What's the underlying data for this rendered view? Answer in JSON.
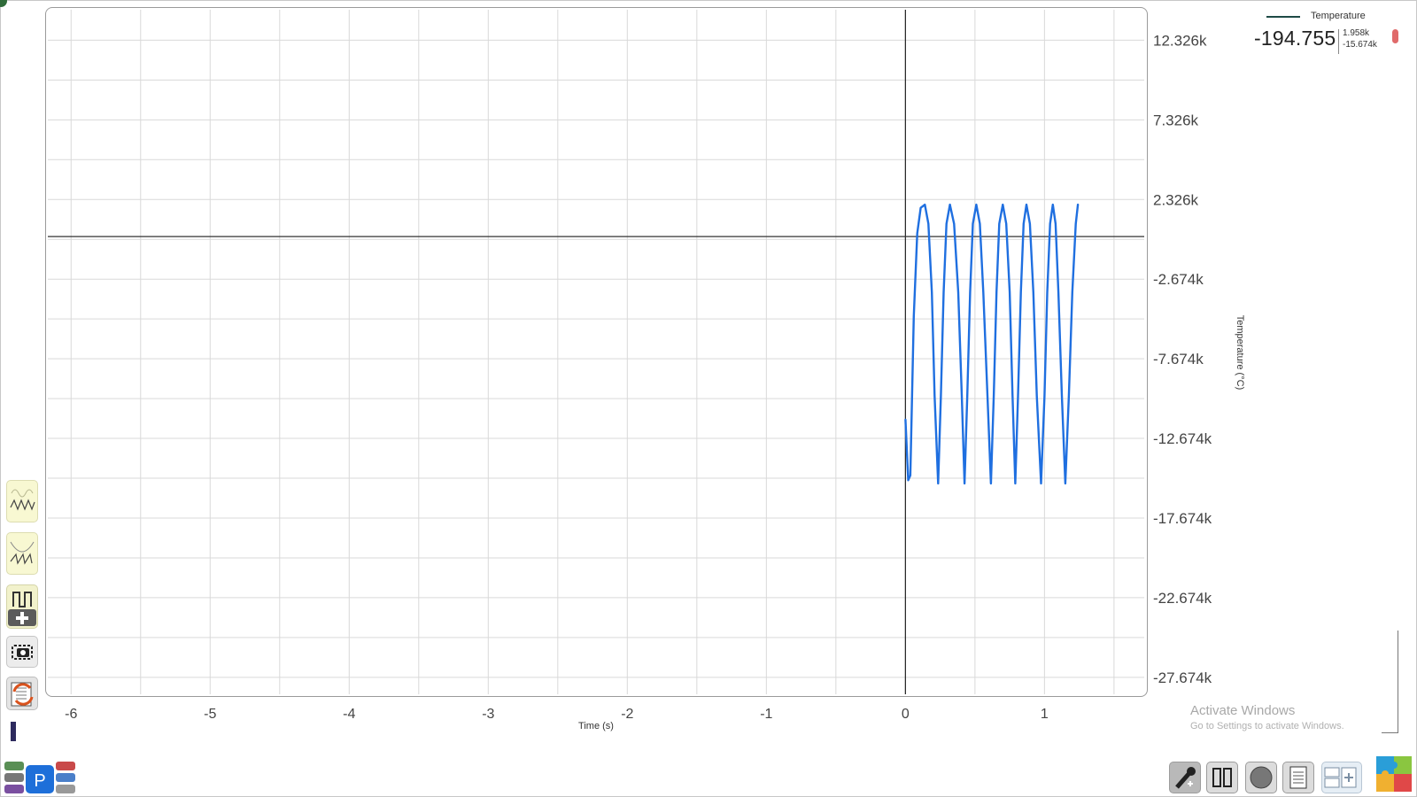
{
  "chart_data": {
    "type": "line",
    "xlabel": "Time (s)",
    "ylabel": "Temperature (°C)",
    "xlim": [
      -6.18,
      1.73
    ],
    "ylim": [
      -28.85,
      14.35
    ],
    "x_ticks": [
      -6,
      -5,
      -4,
      -3,
      -2,
      -1,
      0,
      1
    ],
    "x_tick_labels": [
      "-6",
      "-5",
      "-4",
      "-3",
      "-2",
      "-1",
      "0",
      "1"
    ],
    "y_ticks": [
      12.326,
      7.326,
      2.326,
      -2.674,
      -7.674,
      -12.674,
      -17.674,
      -22.674,
      -27.674
    ],
    "y_tick_labels": [
      "12.326k",
      "7.326k",
      "2.326k",
      "-2.674k",
      "-7.674k",
      "-12.674k",
      "-17.674k",
      "-22.674k",
      "-27.674k"
    ],
    "y_unit_note": "thousands",
    "grid": true,
    "zero_lines": true,
    "series": [
      {
        "name": "Temperature",
        "color": "#1f6fe0",
        "x": [
          0.0,
          0.02,
          0.035,
          0.06,
          0.085,
          0.11,
          0.14,
          0.165,
          0.19,
          0.21,
          0.235,
          0.255,
          0.275,
          0.295,
          0.32,
          0.35,
          0.38,
          0.405,
          0.425,
          0.445,
          0.465,
          0.485,
          0.51,
          0.535,
          0.56,
          0.59,
          0.615,
          0.635,
          0.655,
          0.675,
          0.7,
          0.725,
          0.75,
          0.77,
          0.79,
          0.81,
          0.83,
          0.85,
          0.87,
          0.895,
          0.92,
          0.945,
          0.975,
          1.0,
          1.02,
          1.04,
          1.06,
          1.08,
          1.1,
          1.125,
          1.15,
          1.175,
          1.2,
          1.225,
          1.24
        ],
        "values": [
          -11.5,
          -15.3,
          -15.0,
          -5.0,
          0.2,
          1.8,
          2.0,
          0.8,
          -3.5,
          -10.0,
          -15.5,
          -10.0,
          -3.5,
          0.8,
          2.0,
          0.8,
          -3.5,
          -10.0,
          -15.5,
          -10.0,
          -3.5,
          0.8,
          2.0,
          0.8,
          -3.5,
          -10.0,
          -15.5,
          -10.0,
          -3.5,
          0.8,
          2.0,
          0.8,
          -3.5,
          -10.0,
          -15.5,
          -10.0,
          -3.5,
          0.8,
          2.0,
          0.8,
          -3.5,
          -10.0,
          -15.5,
          -10.0,
          -3.5,
          0.8,
          2.0,
          0.8,
          -3.5,
          -10.0,
          -15.5,
          -10.0,
          -3.5,
          0.8,
          2.0
        ]
      }
    ]
  },
  "legend": {
    "name": "Temperature",
    "current_value": "-194.755",
    "max": "1.958k",
    "min": "-15.674k",
    "line_color": "#1e4a46",
    "marker_color": "#e06a6a"
  },
  "left_toolbar": {
    "items": [
      "signal-view-icon",
      "signal-view-alt-icon",
      "add-signal-icon",
      "snapshot-icon",
      "reset-icon"
    ]
  },
  "bottom_toolbar": {
    "items": [
      "tools-icon",
      "pause-icon",
      "record-icon",
      "notes-icon",
      "layout-icon",
      "puzzle-icon"
    ]
  },
  "watermark": {
    "title": "Activate Windows",
    "subtitle": "Go to Settings to activate Windows."
  }
}
